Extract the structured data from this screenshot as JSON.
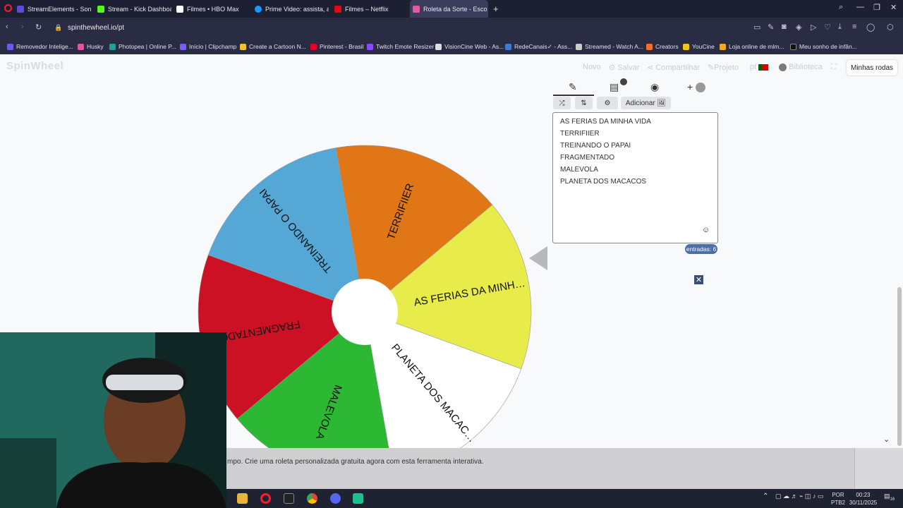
{
  "browser": {
    "tabs": [
      {
        "label": "StreamElements - Son",
        "color": "#5b4cd6"
      },
      {
        "label": "Stream - Kick Dashboard",
        "color": "#53fc18"
      },
      {
        "label": "Filmes • HBO Max",
        "color": "#ffffff"
      },
      {
        "label": "Prime Video: assista, alug",
        "color": "#1a98ff"
      },
      {
        "label": "Filmes – Netflix",
        "color": "#e50914"
      },
      {
        "label": "Roleta da Sorte - Esco",
        "color": "#e35b9c"
      }
    ],
    "url": "spinthewheel.io/pt",
    "bookmarks": [
      {
        "label": "Removedor Intelige...",
        "color": "#6b5cf0"
      },
      {
        "label": "Husky",
        "color": "#e0569a"
      },
      {
        "label": "Photopea | Online P...",
        "color": "#18a497"
      },
      {
        "label": "Início | Clipchamp",
        "color": "#7c5cf5"
      },
      {
        "label": "Create a Cartoon N...",
        "color": "#f2c230"
      },
      {
        "label": "Pinterest - Brasil",
        "color": "#e60023"
      },
      {
        "label": "Twitch Emote Resizer",
        "color": "#9146ff"
      },
      {
        "label": "VisionCine Web - As...",
        "color": "#dddddd"
      },
      {
        "label": "RedeCanais✓ - Ass...",
        "color": "#3a7bd5"
      },
      {
        "label": "Streamed - Watch A...",
        "color": "#cccccc"
      },
      {
        "label": "Creators",
        "color": "#ff6b2b"
      },
      {
        "label": "YouCine",
        "color": "#f5c518"
      },
      {
        "label": "Loja online de mlm...",
        "color": "#f5a623"
      },
      {
        "label": "Meu sonho de infân...",
        "color": "#111111"
      }
    ]
  },
  "app": {
    "logo": "SpinWheel",
    "menu": {
      "novo": "Novo",
      "salvar": "Salvar",
      "compartilhar": "Compartilhar",
      "projeto": "Projeto",
      "lang": "pt",
      "biblioteca": "Biblioteca",
      "minhas_rodas": "Minhas rodas"
    },
    "tool_buttons": {
      "shuffle": "⤮",
      "sort": "⇅",
      "settings": "⚙",
      "add_image": "Adicionar 🖼"
    },
    "entries": [
      "AS FERIAS DA MINHA VIDA",
      "TERRIFIIER",
      "TREINANDO O PAPAI",
      "FRAGMENTADO",
      "MALEVOLA",
      "PLANETA DOS MACACOS"
    ],
    "entries_count": "entradas: 6",
    "footer_text": "mpo. Crie uma roleta personalizada gratuita agora com esta ferramenta interativa."
  },
  "wheel": {
    "segments": [
      {
        "label": "AS FERIAS DA MINH…",
        "color": "#e8ec4a"
      },
      {
        "label": "PLANETA DOS MACAC…",
        "color": "#ffffff"
      },
      {
        "label": "MALEVOLA",
        "color": "#2db834"
      },
      {
        "label": "FRAGMENTADO",
        "color": "#cc1124"
      },
      {
        "label": "TREINANDO O PAPAI",
        "color": "#55a8d6"
      },
      {
        "label": "TERRIFIIER",
        "color": "#e07616"
      }
    ]
  },
  "taskbar": {
    "lang": "POR",
    "layout": "PTB2",
    "time": "00:23",
    "date": "30/11/2025",
    "notif": "16"
  }
}
